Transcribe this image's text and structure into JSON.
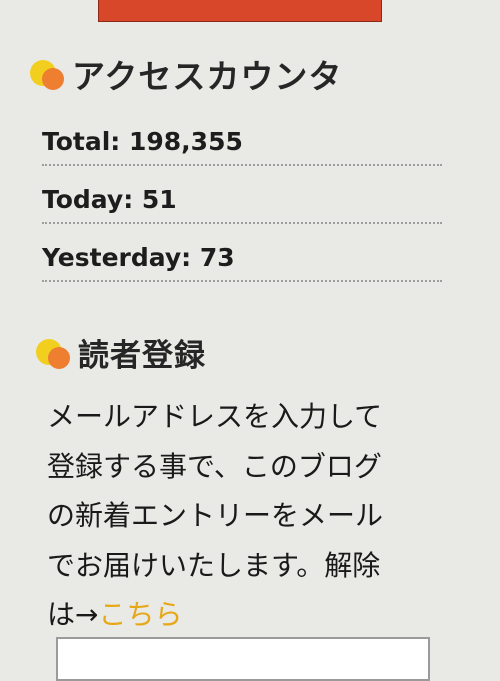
{
  "access_counter": {
    "title": "アクセスカウンタ",
    "rows": {
      "total": "Total: 198,355",
      "today": "Today: 51",
      "yesterday": "Yesterday: 73"
    }
  },
  "reader_registration": {
    "title": "読者登録",
    "description_lines": [
      "メールアドレスを入力して",
      "登録する事で、このブログ",
      "の新着エントリーをメール",
      "でお届けいたします。解除"
    ],
    "unsubscribe_prefix": "は→",
    "unsubscribe_link": "こちら",
    "email_input_value": ""
  },
  "icons": {
    "heading_icon": "two-overlapping-dots-icon"
  },
  "colors": {
    "banner": "#d9472a",
    "icon_yellow": "#f2cf1f",
    "icon_orange": "#ee7f30",
    "link": "#e7a817",
    "background": "#e9e9e6"
  }
}
